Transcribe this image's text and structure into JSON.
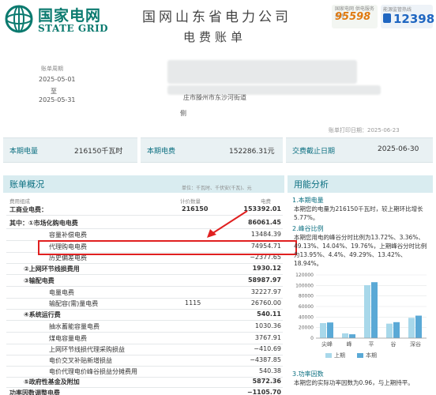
{
  "header": {
    "brand_cn": "国家电网",
    "brand_en": "STATE GRID",
    "org_name": "国网山东省电力公司",
    "doc_title": "电费账单",
    "hotline_95598": "95598",
    "hotline_12398": "12398",
    "hotline_95598_sub": "国家电网 供电服务热线",
    "hotline_12398_sub": "能源监管热线"
  },
  "info": {
    "period_label": "账单周期",
    "period_start": "2025-05-01",
    "period_to": "至",
    "period_end": "2025-05-31",
    "address_partial": "庄市滕州市东沙河街道",
    "address_partial2": "侧",
    "print_date": "账单打印日期：2025-06-23"
  },
  "summary": {
    "usage_label": "本期电量",
    "usage_value": "216150千瓦时",
    "charge_label": "本期电费",
    "charge_value": "152286.31元",
    "due_label": "交费截止日期",
    "due_value": "2025-06-30"
  },
  "overview": {
    "title": "账单概况",
    "unit_note": "单位：千瓦时、千伏安(千瓦)、元",
    "col_item": "费用组成",
    "col_qty": "计价数量",
    "col_amt": "电费",
    "rows": [
      {
        "label": "工商业电费：",
        "qty": "216150",
        "amount": "153392.01"
      },
      {
        "label": "其中：①市场化购电电费",
        "qty": "",
        "amount": "86061.45"
      },
      {
        "label": "容量补偿电费",
        "qty": "",
        "amount": "13484.39"
      },
      {
        "label": "代理购电电费",
        "qty": "",
        "amount": "74954.71"
      },
      {
        "label": "历史偏差电费",
        "qty": "",
        "amount": "−2377.65"
      },
      {
        "label": "②上网环节线损费用",
        "qty": "",
        "amount": "1930.12"
      },
      {
        "label": "③输配电费",
        "qty": "",
        "amount": "58987.97"
      },
      {
        "label": "电量电费",
        "qty": "",
        "amount": "32227.97"
      },
      {
        "label": "输配容(需)量电费",
        "qty": "1115",
        "amount": "26760.00"
      },
      {
        "label": "④系统运行费",
        "qty": "",
        "amount": "540.11"
      },
      {
        "label": "抽水蓄能容量电费",
        "qty": "",
        "amount": "1030.36"
      },
      {
        "label": "煤电容量电费",
        "qty": "",
        "amount": "3767.91"
      },
      {
        "label": "上网环节线损代理采购损益",
        "qty": "",
        "amount": "−410.69"
      },
      {
        "label": "电价交叉补贴新增损益",
        "qty": "",
        "amount": "−4387.85"
      },
      {
        "label": "电价代理电价峰谷损益分摊费用",
        "qty": "",
        "amount": "540.38"
      },
      {
        "label": "⑤政府性基金及附加",
        "qty": "",
        "amount": "5872.36"
      },
      {
        "label": "功率因数调整电费",
        "qty": "",
        "amount": "−1105.70"
      }
    ]
  },
  "analysis": {
    "title": "用能分析",
    "section1_title": "1.本期电量",
    "section1_text": "本期您的电量为216150千瓦时，较上期环比增长5.77%。",
    "section2_title": "2.峰谷比例",
    "section2_text": "本期您用电的峰谷分时比例为13.72%、3.36%、49.13%、14.04%、19.76%，上期峰谷分时比例为13.95%、4.4%、49.29%、13.42%、18.94%。",
    "section3_title": "3.功率因数",
    "section3_text": "本期您的实际功率因数为0.96，与上期持平。",
    "legend_prev": "上期",
    "legend_curr": "本期"
  },
  "chart_data": {
    "type": "bar",
    "categories": [
      "尖峰",
      "峰",
      "平",
      "谷",
      "深谷"
    ],
    "series": [
      {
        "name": "上期",
        "values": [
          28500,
          9000,
          100500,
          27500,
          38500
        ]
      },
      {
        "name": "本期",
        "values": [
          29700,
          7300,
          106200,
          30300,
          42700
        ]
      }
    ],
    "ylim": [
      0,
      120000
    ],
    "yticks": [
      "0",
      "20000",
      "40000",
      "60000",
      "80000",
      "100000",
      "120000"
    ],
    "colors": {
      "上期": "#a8d8ea",
      "本期": "#5aa9d6"
    }
  },
  "colors": {
    "brand": "#0b7a6f",
    "accent": "#0b6f80",
    "highlight": "#e02020"
  }
}
